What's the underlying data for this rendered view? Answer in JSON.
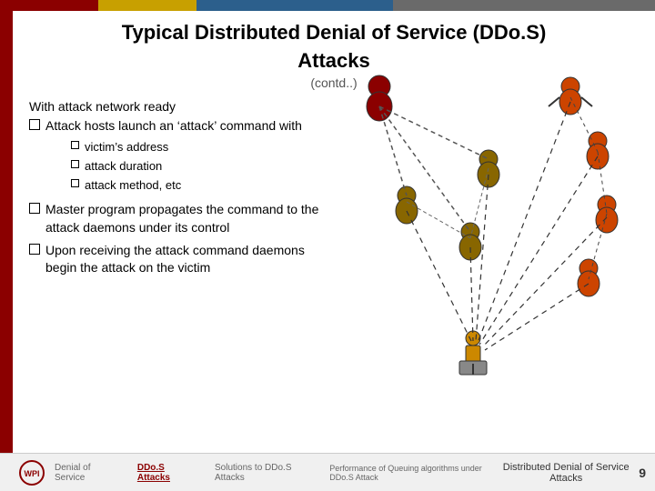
{
  "slide": {
    "top_bar_visible": true,
    "title": "Typical Distributed Denial of Service (DDo.S)",
    "title_line2": "Attacks",
    "subtitle": "(contd..)",
    "intro_text": "With attack network ready",
    "bullets": [
      {
        "id": "bullet1",
        "text": "Attack hosts launch an ‘attack’ command with",
        "sub_bullets": [
          {
            "id": "sub1",
            "text": "victim’s address"
          },
          {
            "id": "sub2",
            "text": "attack duration"
          },
          {
            "id": "sub3",
            "text": "attack method, etc"
          }
        ]
      },
      {
        "id": "bullet2",
        "text": "Master program propagates the command to the attack daemons under its control",
        "sub_bullets": []
      },
      {
        "id": "bullet3",
        "text": "Upon receiving the attack command daemons begin the attack on the victim",
        "sub_bullets": []
      }
    ],
    "footer": {
      "nav_items": [
        {
          "id": "nav1",
          "label": "Denial of Service",
          "active": false
        },
        {
          "id": "nav2",
          "label": "DDo.S Attacks",
          "active": true
        },
        {
          "id": "nav3",
          "label": "Solutions to DDo.S Attacks",
          "active": false
        },
        {
          "id": "nav4",
          "label": "Performance of Queuing algorithms under DDo.S Attack",
          "active": false
        }
      ],
      "center_label": "Distributed Denial of Service Attacks",
      "page_number": "9"
    }
  }
}
